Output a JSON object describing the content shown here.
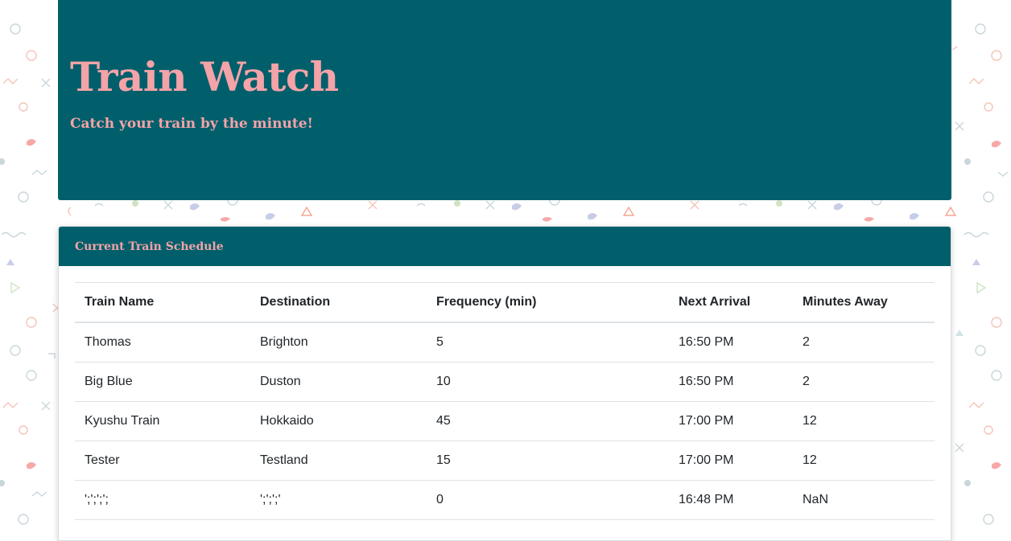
{
  "header": {
    "title": "Train Watch",
    "subtitle": "Catch your train by the minute!"
  },
  "schedule": {
    "title": "Current Train Schedule",
    "columns": [
      "Train Name",
      "Destination",
      "Frequency (min)",
      "Next Arrival",
      "Minutes Away"
    ],
    "rows": [
      [
        "Thomas",
        "Brighton",
        "5",
        "16:50 PM",
        "2"
      ],
      [
        "Big Blue",
        "Duston",
        "10",
        "16:50 PM",
        "2"
      ],
      [
        "Kyushu Train",
        "Hokkaido",
        "45",
        "17:00 PM",
        "12"
      ],
      [
        "Tester",
        "Testland",
        "15",
        "17:00 PM",
        "12"
      ],
      [
        "';';';';",
        "';';';'",
        "0",
        "16:48 PM",
        "NaN"
      ]
    ]
  },
  "theme": {
    "primary": "#005f6b",
    "accent": "#f4a3a8"
  }
}
